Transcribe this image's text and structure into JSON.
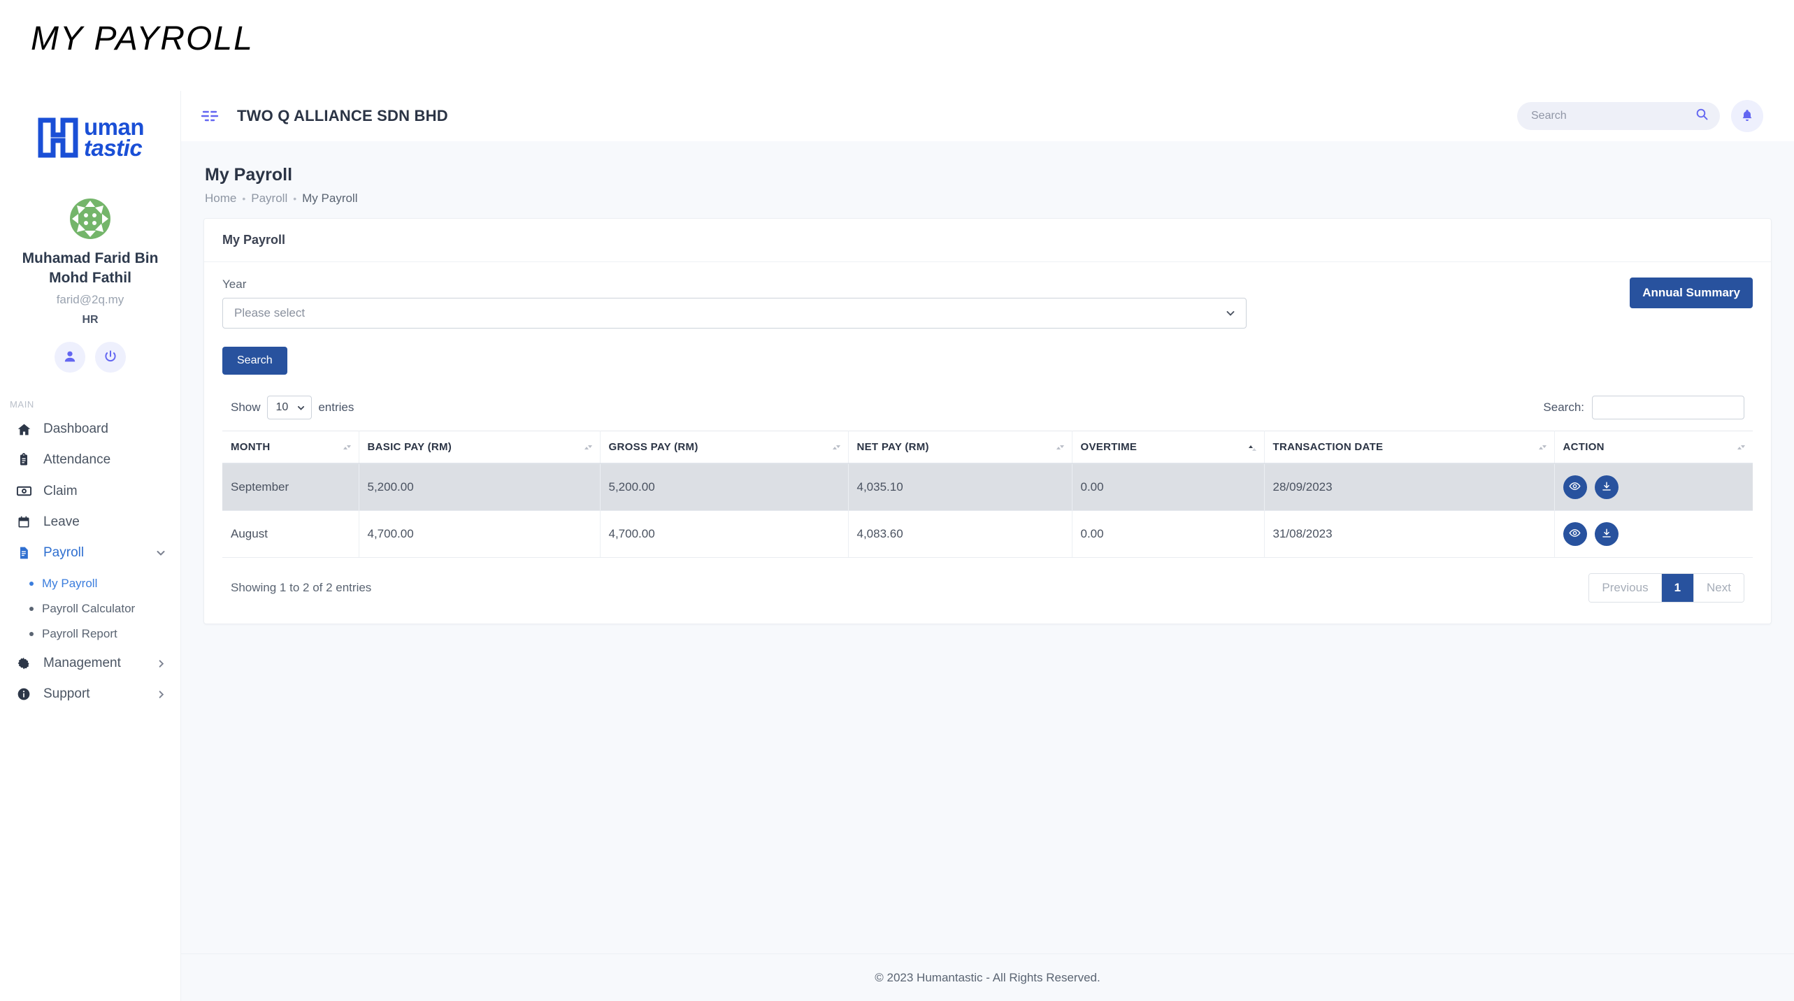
{
  "banner": {
    "title": "MY PAYROLL"
  },
  "brand": {
    "line1": "uman",
    "line2": "tastic",
    "color": "#1a4fd6"
  },
  "sidebar": {
    "user": {
      "name": "Muhamad Farid Bin Mohd Fathil",
      "email": "farid@2q.my",
      "role": "HR"
    },
    "actions": [
      {
        "name": "profile-button",
        "icon": "user-icon"
      },
      {
        "name": "logout-button",
        "icon": "power-icon"
      }
    ],
    "section_label": "MAIN",
    "items": [
      {
        "label": "Dashboard",
        "icon": "home-icon",
        "active": false,
        "caret": ""
      },
      {
        "label": "Attendance",
        "icon": "clipboard-icon",
        "active": false,
        "caret": ""
      },
      {
        "label": "Claim",
        "icon": "money-icon",
        "active": false,
        "caret": ""
      },
      {
        "label": "Leave",
        "icon": "calendar-icon",
        "active": false,
        "caret": ""
      },
      {
        "label": "Payroll",
        "icon": "document-icon",
        "active": true,
        "caret": "down"
      },
      {
        "label": "Management",
        "icon": "gear-icon",
        "active": false,
        "caret": "right"
      },
      {
        "label": "Support",
        "icon": "info-icon",
        "active": false,
        "caret": "right"
      }
    ],
    "subitems": [
      {
        "label": "My Payroll",
        "active": true
      },
      {
        "label": "Payroll Calculator",
        "active": false
      },
      {
        "label": "Payroll Report",
        "active": false
      }
    ]
  },
  "topbar": {
    "company": "TWO Q ALLIANCE SDN BHD",
    "search_placeholder": "Search",
    "search_value": ""
  },
  "page": {
    "title": "My Payroll",
    "breadcrumb": [
      "Home",
      "Payroll",
      "My Payroll"
    ]
  },
  "card": {
    "title": "My Payroll",
    "year_label": "Year",
    "year_value": "Please select",
    "annual_summary_label": "Annual Summary",
    "search_button_label": "Search"
  },
  "table_tools": {
    "show_label": "Show",
    "entries_value": "10",
    "entries_label": "entries",
    "search_label": "Search:",
    "search_value": ""
  },
  "table": {
    "columns": [
      {
        "label": "MONTH",
        "sort": "none"
      },
      {
        "label": "BASIC PAY (RM)",
        "sort": "none"
      },
      {
        "label": "GROSS PAY (RM)",
        "sort": "none"
      },
      {
        "label": "NET PAY (RM)",
        "sort": "none"
      },
      {
        "label": "OVERTIME",
        "sort": "asc"
      },
      {
        "label": "TRANSACTION DATE",
        "sort": "none"
      },
      {
        "label": "ACTION",
        "sort": "none"
      }
    ],
    "rows": [
      {
        "month": "September",
        "basic_pay": "5,200.00",
        "gross_pay": "5,200.00",
        "net_pay": "4,035.10",
        "overtime": "0.00",
        "transaction_date": "28/09/2023"
      },
      {
        "month": "August",
        "basic_pay": "4,700.00",
        "gross_pay": "4,700.00",
        "net_pay": "4,083.60",
        "overtime": "0.00",
        "transaction_date": "31/08/2023"
      }
    ],
    "row_actions": [
      {
        "name": "view-payslip-button",
        "icon": "eye-icon"
      },
      {
        "name": "download-payslip-button",
        "icon": "download-icon"
      }
    ]
  },
  "table_foot": {
    "showing": "Showing 1 to 2 of 2 entries",
    "previous": "Previous",
    "page_1": "1",
    "next": "Next"
  },
  "footer": {
    "text": "© 2023 Humantastic - All Rights Reserved."
  },
  "colors": {
    "primary": "#28529e",
    "accent": "#3b7ddd",
    "brand": "#1a4fd6",
    "icon_purple": "#6366f1",
    "page_bg": "#f7f9fc"
  }
}
